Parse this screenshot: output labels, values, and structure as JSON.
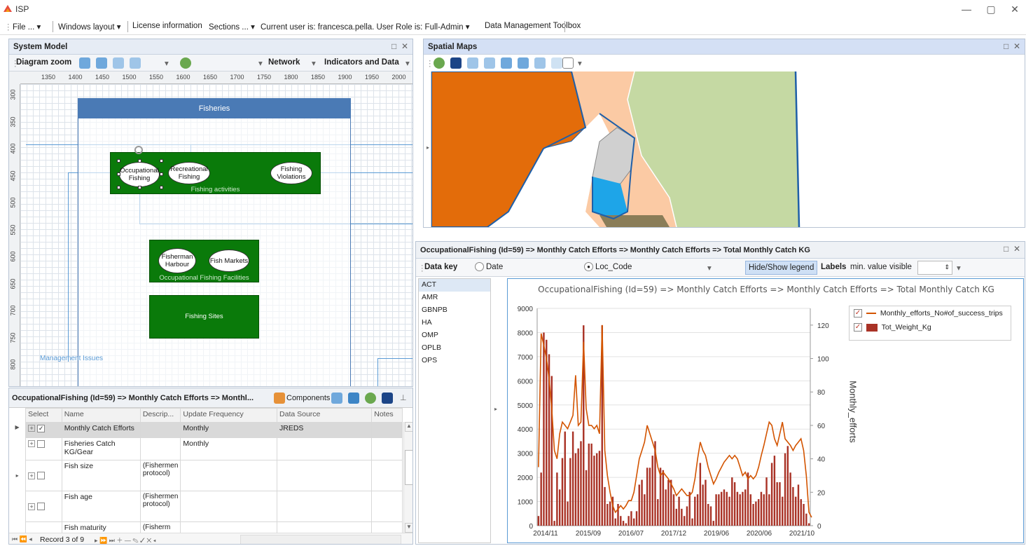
{
  "app": {
    "title": "ISP"
  },
  "menu": {
    "file": "File ...",
    "windows_layout": "Windows layout",
    "license": "License information",
    "sections": "Sections ...",
    "user_info": "Current user is: francesca.pella. User Role is: Full-Admin",
    "toolbox": "Data Management Toolbox"
  },
  "system_model": {
    "title": "System Model",
    "toolbar": {
      "diagram_zoom": "Diagram zoom",
      "network": "Network",
      "indicators": "Indicators and Data"
    },
    "ruler_h": [
      "1350",
      "1400",
      "1450",
      "1500",
      "1550",
      "1600",
      "1650",
      "1700",
      "1750",
      "1800",
      "1850",
      "1900",
      "1950",
      "2000"
    ],
    "ruler_v": [
      "300",
      "350",
      "400",
      "450",
      "500",
      "550",
      "600",
      "650",
      "700",
      "750",
      "800",
      "850"
    ],
    "fisheries_title": "Fisheries",
    "fishing_activities": {
      "label": "Fishing activities",
      "items": [
        "Occupational Fishing",
        "Recreational Fishing",
        "Fishing Violations"
      ]
    },
    "facilities": {
      "label": "Occupational Fishing Facilities",
      "items": [
        "Fisherman Harbour",
        "Fish Markets"
      ]
    },
    "fishing_sites": "Fishing Sites",
    "management_issues": "Management Issues"
  },
  "data_grid": {
    "title": "OccupationalFishing (Id=59) => Monthly Catch Efforts => Monthl...",
    "components_label": "Components",
    "columns": [
      "Select",
      "Name",
      "Descrip...",
      "Update Frequency",
      "Data Source",
      "Notes"
    ],
    "rows": [
      {
        "name": "Monthly Catch Efforts",
        "desc": "",
        "freq": "Monthly",
        "source": "JREDS",
        "notes": ""
      },
      {
        "name": "Fisheries Catch KG/Gear",
        "desc": "",
        "freq": "Monthly",
        "source": "",
        "notes": ""
      },
      {
        "name": "Fish size",
        "desc": "(Fishermen protocol)",
        "freq": "",
        "source": "",
        "notes": ""
      },
      {
        "name": "Fish age",
        "desc": "(Fishermen protocol)",
        "freq": "",
        "source": "",
        "notes": ""
      },
      {
        "name": "Fish maturity",
        "desc": "(Fisherm",
        "freq": "",
        "source": "",
        "notes": ""
      }
    ],
    "record_nav": "Record 3 of 9"
  },
  "spatial_maps": {
    "title": "Spatial Maps"
  },
  "chart_panel": {
    "title": "OccupationalFishing (Id=59) => Monthly Catch Efforts => Monthly Catch Efforts => Total Monthly Catch KG",
    "toolbar": {
      "data_key": "Data key",
      "date": "Date",
      "loc_code": "Loc_Code",
      "hide_show_legend": "Hide/Show legend",
      "labels": "Labels",
      "min_value": "min. value",
      "visible": "visible"
    },
    "keys": [
      "ACT",
      "AMR",
      "GBNPB",
      "HA",
      "OMP",
      "OPLB",
      "OPS"
    ]
  },
  "colors": {
    "bar": "#a93226",
    "line": "#d35400",
    "green": "#0a7a0a",
    "header_blue": "#4a7ab5"
  },
  "chart_data": {
    "type": "bar",
    "title": "OccupationalFishing (Id=59) => Monthly Catch Efforts => Monthly Catch Efforts => Total Monthly Catch KG",
    "xlabel": "",
    "ylabel": "",
    "y2label": "Monthly_efforts",
    "ylim": [
      0,
      9000
    ],
    "y2lim": [
      0,
      130
    ],
    "yticks": [
      "0",
      "1000",
      "2000",
      "3000",
      "4000",
      "5000",
      "6000",
      "7000",
      "8000",
      "9000"
    ],
    "y2ticks": [
      "0",
      "20",
      "40",
      "60",
      "80",
      "100",
      "120"
    ],
    "xticks": [
      "2014/11",
      "2015/09",
      "2016/07",
      "2017/12",
      "2019/06",
      "2020/06",
      "2021/10"
    ],
    "legend": "top-right",
    "series": [
      {
        "name": "Tot_Weight_Kg",
        "kind": "bar",
        "values": [
          400,
          2200,
          8000,
          7700,
          7100,
          6200,
          200,
          2200,
          1500,
          2800,
          3900,
          1000,
          2800,
          3900,
          3000,
          3200,
          3500,
          8300,
          2300,
          3400,
          3400,
          2900,
          3000,
          3100,
          8300,
          1600,
          900,
          1000,
          1200,
          300,
          900,
          400,
          200,
          100,
          400,
          600,
          300,
          600,
          1700,
          1900,
          1300,
          2400,
          2400,
          2900,
          3500,
          1100,
          2400,
          2300,
          1500,
          1900,
          1900,
          1300,
          700,
          1200,
          700,
          400,
          800,
          1400,
          300,
          1200,
          1300,
          2600,
          1700,
          1900,
          900,
          800,
          200,
          1300,
          1300,
          1400,
          1500,
          1400,
          1200,
          2000,
          1800,
          1400,
          1300,
          1400,
          1500,
          2200,
          1300,
          900,
          1000,
          1100,
          1400,
          1300,
          2000,
          1300,
          2600,
          2900,
          1800,
          1800,
          1200,
          3000,
          3300,
          2200,
          1600,
          1200,
          1700,
          1100,
          900,
          500,
          100
        ]
      },
      {
        "name": "Monthly_efforts_No#of_success_trips",
        "kind": "line",
        "values": [
          35,
          115,
          108,
          100,
          88,
          70,
          45,
          40,
          55,
          62,
          60,
          58,
          62,
          66,
          90,
          60,
          62,
          110,
          70,
          60,
          60,
          58,
          60,
          55,
          120,
          45,
          30,
          20,
          12,
          8,
          10,
          12,
          10,
          12,
          15,
          15,
          20,
          30,
          40,
          45,
          50,
          60,
          55,
          50,
          45,
          35,
          30,
          32,
          30,
          28,
          25,
          22,
          18,
          20,
          22,
          20,
          18,
          18,
          20,
          28,
          40,
          50,
          45,
          42,
          35,
          30,
          25,
          28,
          32,
          35,
          38,
          40,
          42,
          40,
          42,
          40,
          35,
          30,
          32,
          28,
          30,
          28,
          30,
          35,
          42,
          48,
          55,
          62,
          60,
          52,
          48,
          55,
          62,
          52,
          50,
          48,
          45,
          48,
          50,
          52,
          45,
          30,
          8,
          5
        ]
      }
    ]
  }
}
